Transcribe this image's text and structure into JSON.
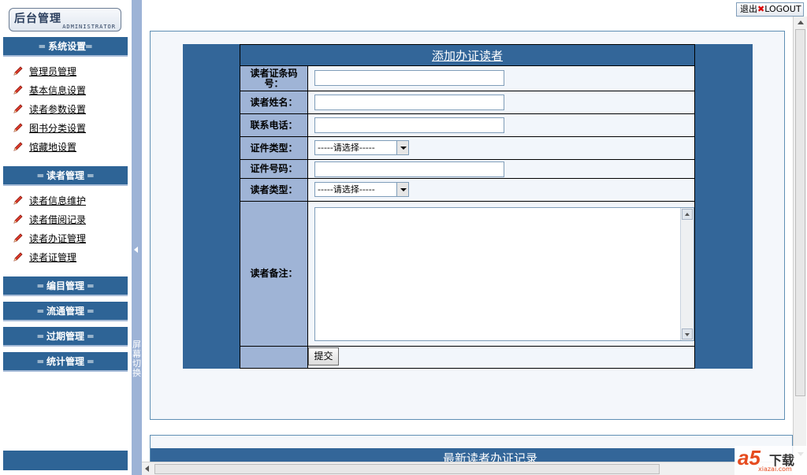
{
  "sidebar": {
    "logo_title": "后台管理",
    "logo_subtitle": "ADMINISTRATOR",
    "sections": [
      {
        "title": "═ 系统设置═",
        "items": [
          "管理员管理",
          "基本信息设置",
          "读者参数设置",
          "图书分类设置",
          "馆藏地设置"
        ]
      },
      {
        "title": "═ 读者管理 ═",
        "items": [
          "读者信息维护",
          "读者借阅记录",
          "读者办证管理",
          "读者证管理"
        ]
      },
      {
        "title": "═ 编目管理 ═",
        "items": []
      },
      {
        "title": "═ 流通管理 ═",
        "items": []
      },
      {
        "title": "═ 过期管理 ═",
        "items": []
      },
      {
        "title": "═ 统计管理 ═",
        "items": []
      }
    ]
  },
  "splitter": {
    "label": "屏幕切换"
  },
  "header": {
    "logout_cn": "退出",
    "logout_en": "LOGOUT"
  },
  "form": {
    "title": "添加办证读者",
    "fields": {
      "card_barcode": {
        "label": "读者证条码号：",
        "value": ""
      },
      "name": {
        "label": "读者姓名：",
        "value": ""
      },
      "phone": {
        "label": "联系电话：",
        "value": ""
      },
      "id_type": {
        "label": "证件类型：",
        "selected": "-----请选择-----"
      },
      "id_number": {
        "label": "证件号码：",
        "value": ""
      },
      "reader_type": {
        "label": "读者类型：",
        "selected": "-----请选择-----"
      },
      "remarks": {
        "label": "读者备注：",
        "value": ""
      }
    },
    "submit_label": "提交"
  },
  "recent": {
    "title": "最新读者办证记录"
  },
  "watermark": {
    "brand": "a5",
    "cn": "下载",
    "url": "xiazai.com"
  },
  "colors": {
    "nav_blue": "#2e6496",
    "frame_blue": "#336699",
    "label_bg": "#9fb4d6",
    "splitter": "#9db3d6"
  },
  "icons": [
    "pencil-icon",
    "close-icon",
    "chevron-left-icon",
    "chevron-down-icon"
  ]
}
